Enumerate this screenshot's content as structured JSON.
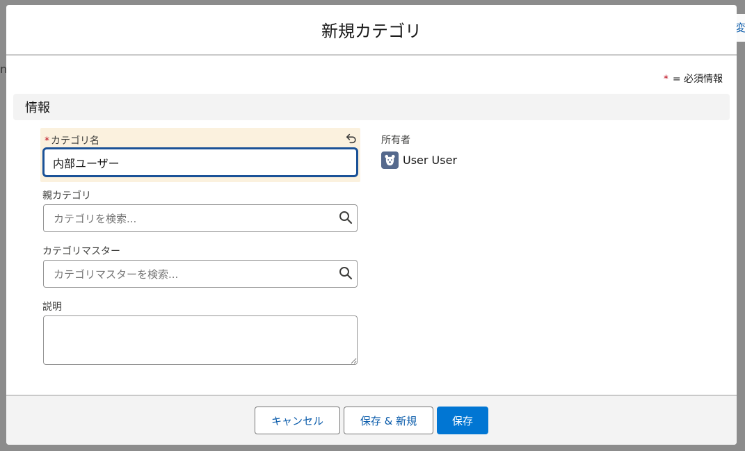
{
  "backdrop": {
    "edge_text": "変"
  },
  "modal": {
    "title": "新規カテゴリ",
    "required_legend": {
      "star": "*",
      "text": "= 必須情報"
    },
    "section": {
      "title": "情報"
    },
    "fields": {
      "category_name": {
        "required_mark": "*",
        "label": "カテゴリ名",
        "value": "内部ユーザー",
        "undo_icon": "undo-icon"
      },
      "parent_category": {
        "label": "親カテゴリ",
        "placeholder": "カテゴリを検索...",
        "icon": "search-icon"
      },
      "category_master": {
        "label": "カテゴリマスター",
        "placeholder": "カテゴリマスターを検索...",
        "icon": "search-icon"
      },
      "description": {
        "label": "説明",
        "value": ""
      },
      "owner": {
        "label": "所有者",
        "value": "User User",
        "avatar_icon": "bear-avatar-icon"
      }
    },
    "footer": {
      "cancel_label": "キャンセル",
      "save_new_label": "保存 & 新規",
      "save_label": "保存"
    }
  },
  "colors": {
    "brand": "#0176d3",
    "required": "#ba0517",
    "focus_border": "#1b5297",
    "edited_field_bg": "#fbf1de",
    "avatar_bg": "#55698d"
  }
}
